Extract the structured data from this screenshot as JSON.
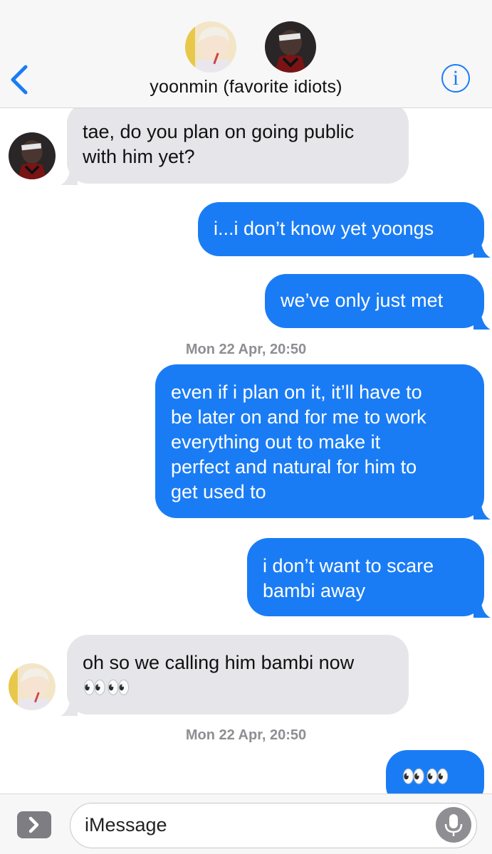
{
  "header": {
    "title": "yoonmin (favorite idiots)",
    "back_icon": "chevron-left-icon",
    "info_label": "i"
  },
  "messages": [
    {
      "direction": "incoming",
      "sender": "yoongi",
      "lines": [
        "tae, do you plan on going public",
        "with him yet?"
      ]
    },
    {
      "direction": "outgoing",
      "lines": [
        "i...i don’t know yet yoongs"
      ]
    },
    {
      "direction": "outgoing",
      "lines": [
        "we’ve only just met"
      ]
    },
    {
      "type": "timestamp",
      "day": "Mon 22 Apr,",
      "time": "20:50"
    },
    {
      "direction": "outgoing",
      "lines": [
        "even if i plan on it, it’ll have to",
        "be later on and for me to work",
        "everything out to make it",
        "perfect and natural for him to",
        "get used to"
      ]
    },
    {
      "direction": "outgoing",
      "lines": [
        "i don’t want to scare",
        "bambi away"
      ]
    },
    {
      "direction": "incoming",
      "sender": "jimin",
      "lines": [
        "oh so we calling him bambi now",
        "👀👀"
      ]
    },
    {
      "type": "timestamp",
      "day": "Mon 22 Apr,",
      "time": "20:50"
    },
    {
      "direction": "outgoing",
      "lines": [
        "👀👀"
      ]
    }
  ],
  "input": {
    "placeholder": "iMessage"
  },
  "colors": {
    "outgoing": "#1a7cf5",
    "incoming": "#e5e5ea",
    "accent": "#1a7cf5"
  }
}
